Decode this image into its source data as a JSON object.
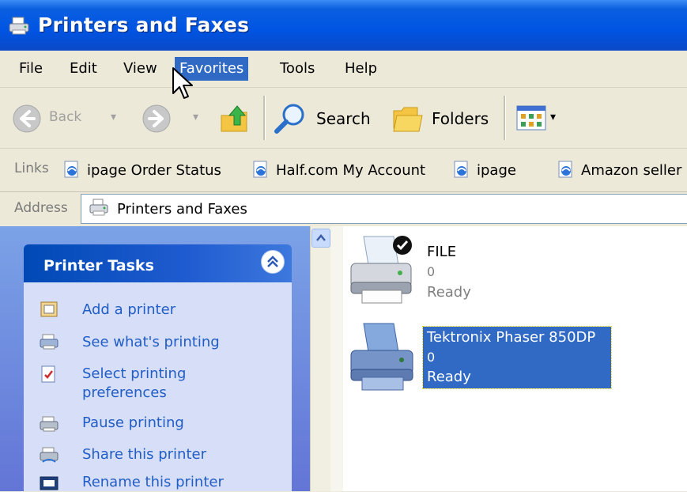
{
  "window": {
    "title": "Printers and Faxes"
  },
  "menu": {
    "items": [
      {
        "label": "File"
      },
      {
        "label": "Edit"
      },
      {
        "label": "View"
      },
      {
        "label": "Favorites"
      },
      {
        "label": "Tools"
      },
      {
        "label": "Help"
      }
    ],
    "active": "Favorites"
  },
  "toolbar": {
    "back_label": "Back",
    "search_label": "Search",
    "folders_label": "Folders"
  },
  "links": {
    "label": "Links",
    "items": [
      {
        "label": "ipage Order Status"
      },
      {
        "label": "Half.com My Account"
      },
      {
        "label": "ipage"
      },
      {
        "label": "Amazon seller"
      }
    ]
  },
  "address": {
    "label": "Address",
    "value": "Printers and Faxes"
  },
  "printer_tasks": {
    "title": "Printer Tasks",
    "items": [
      {
        "label": "Add a printer"
      },
      {
        "label": "See what's printing"
      },
      {
        "label": "Select printing preferences"
      },
      {
        "label": "Pause printing"
      },
      {
        "label": "Share this printer"
      },
      {
        "label": "Rename this printer"
      }
    ]
  },
  "printers": [
    {
      "name": "FILE",
      "documents": "0",
      "status": "Ready",
      "default": true,
      "selected": false
    },
    {
      "name": "Tektronix Phaser 850DP",
      "documents": "0",
      "status": "Ready",
      "default": false,
      "selected": true
    }
  ],
  "colors": {
    "title_bar": "#0054e3",
    "selection": "#316ac5",
    "task_link": "#215dc6",
    "task_pane": "#6375d6"
  }
}
